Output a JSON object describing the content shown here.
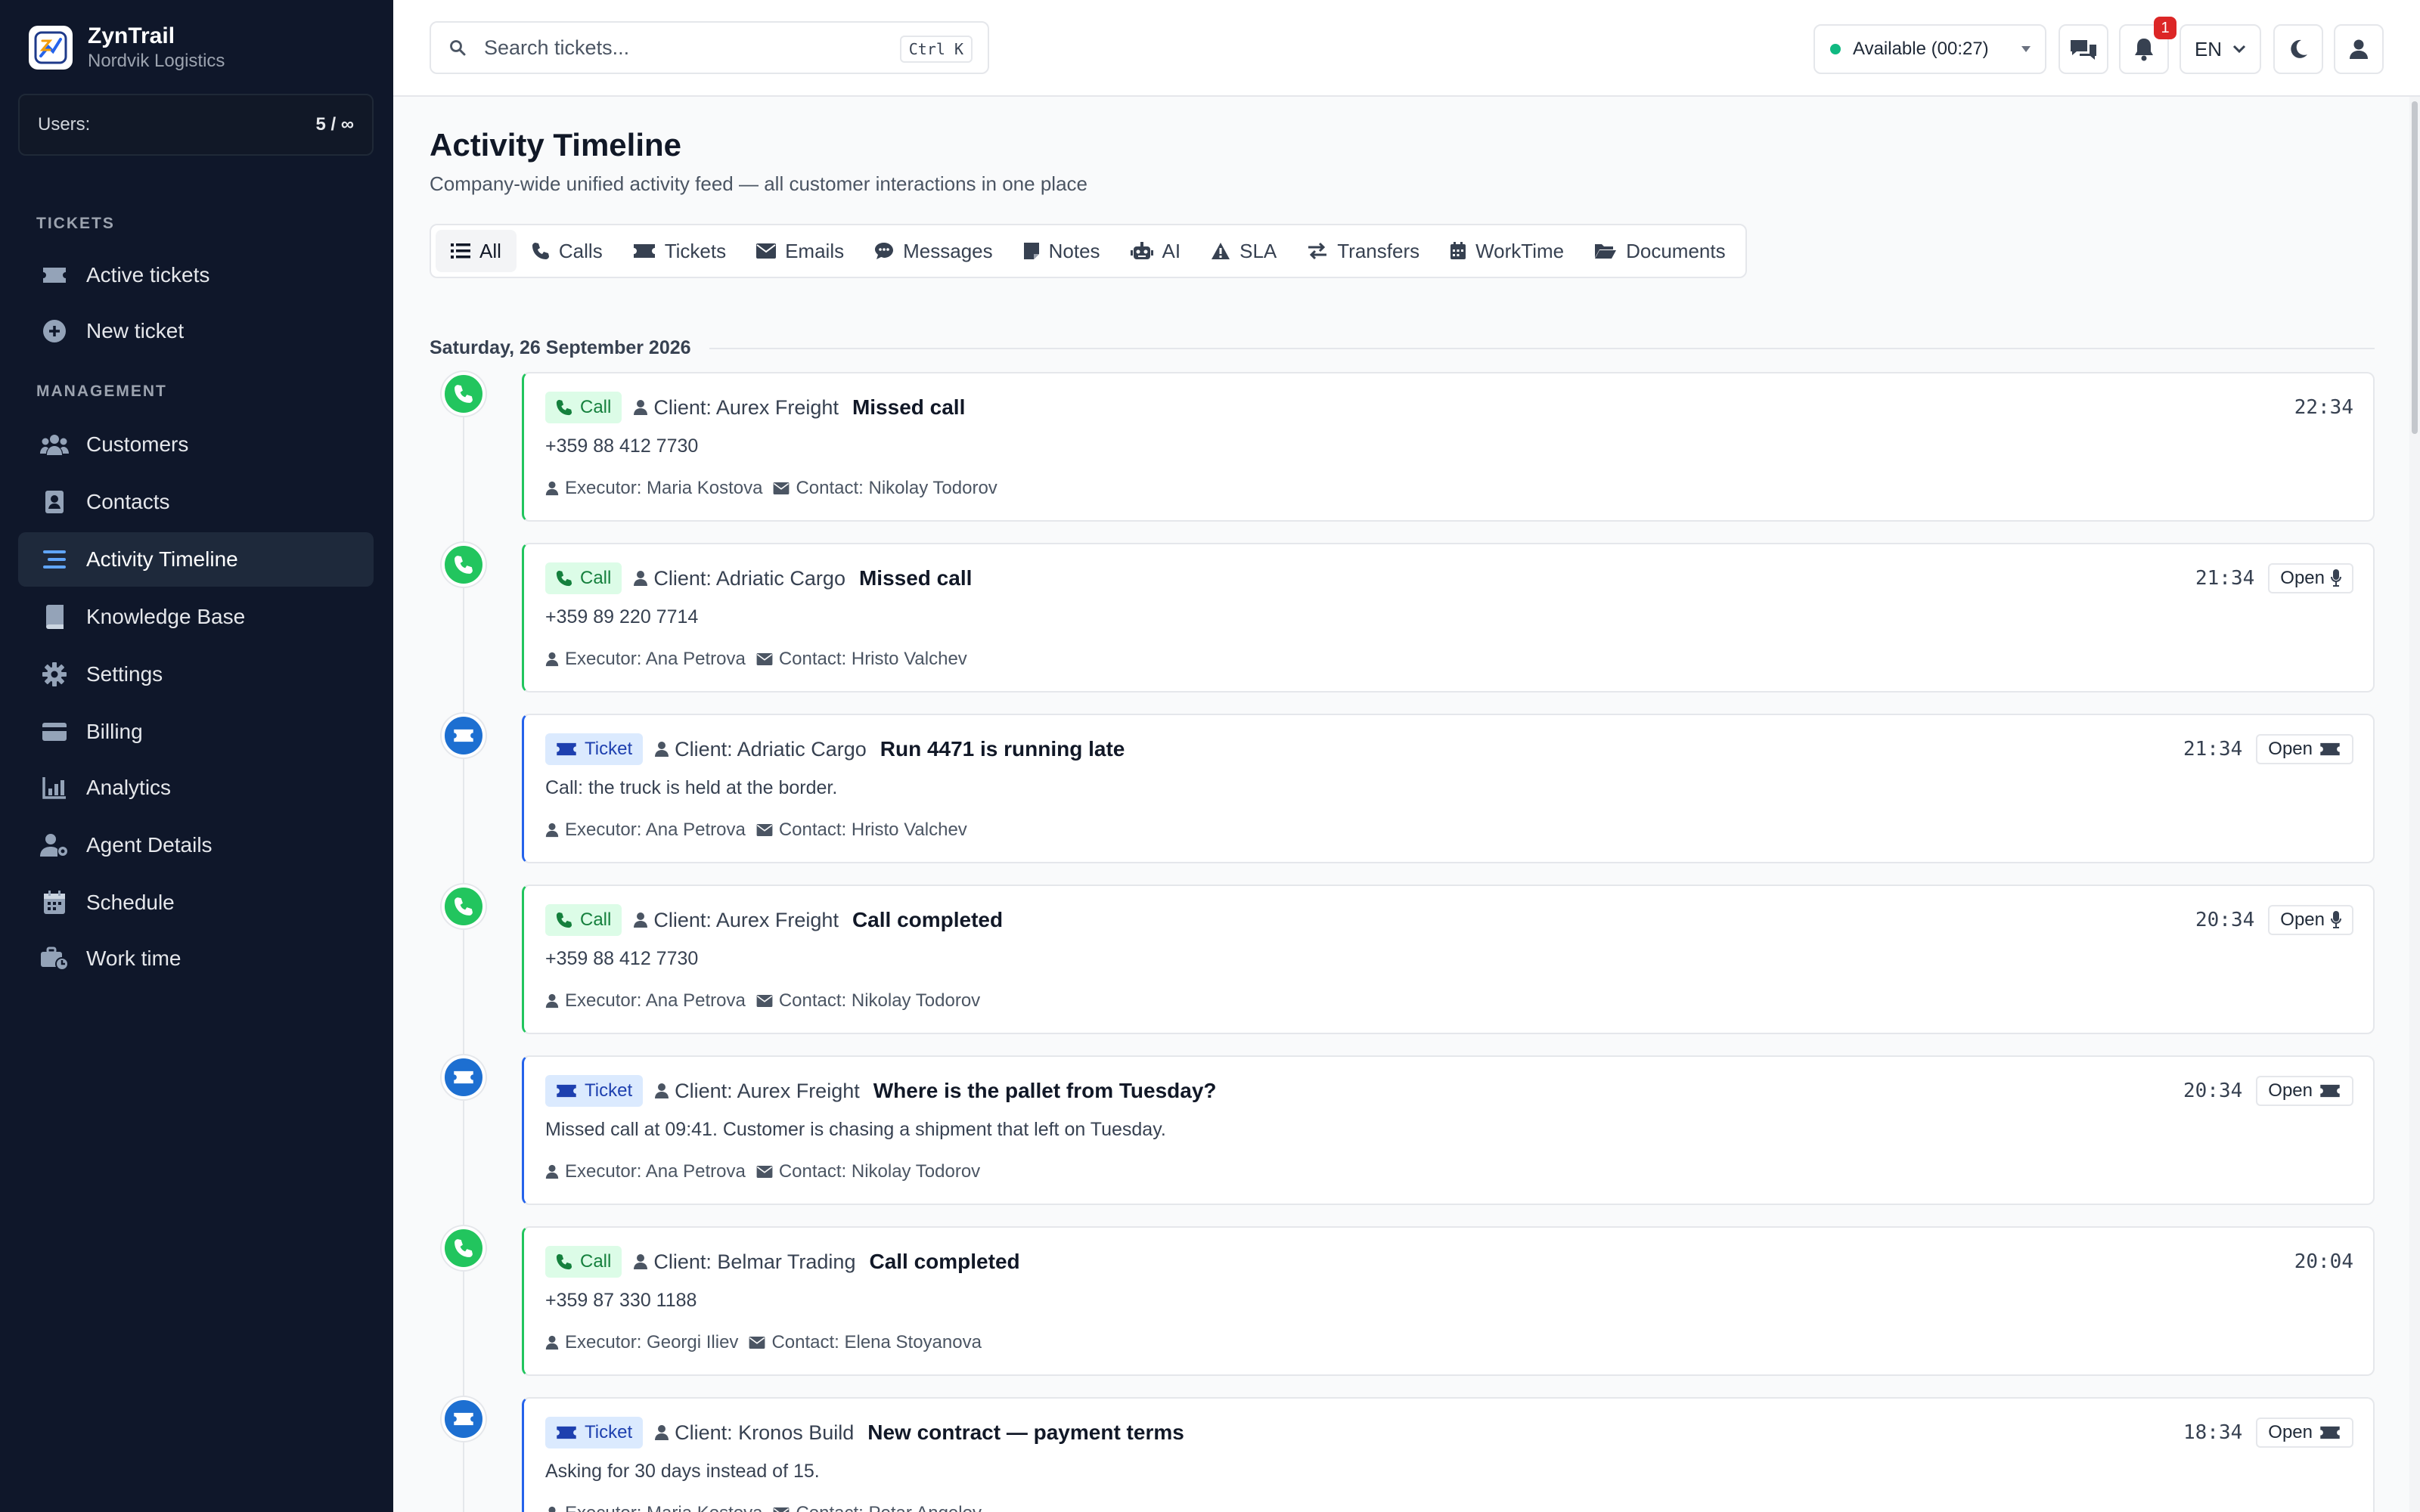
{
  "brand": {
    "name": "ZynTrail",
    "company": "Nordvik Logistics"
  },
  "users": {
    "label": "Users:",
    "value": "5 / ∞"
  },
  "sidebar": {
    "tickets_heading": "TICKETS",
    "management_heading": "MANAGEMENT",
    "items": [
      {
        "label": "Active tickets",
        "icon": "ticket-icon"
      },
      {
        "label": "New ticket",
        "icon": "plus-circle-icon"
      },
      {
        "label": "Customers",
        "icon": "users-icon"
      },
      {
        "label": "Contacts",
        "icon": "contact-book-icon"
      },
      {
        "label": "Activity Timeline",
        "icon": "timeline-icon",
        "active": true
      },
      {
        "label": "Knowledge Base",
        "icon": "book-icon"
      },
      {
        "label": "Settings",
        "icon": "gear-icon"
      },
      {
        "label": "Billing",
        "icon": "credit-card-icon"
      },
      {
        "label": "Analytics",
        "icon": "chart-icon"
      },
      {
        "label": "Agent Details",
        "icon": "user-gear-icon"
      },
      {
        "label": "Schedule",
        "icon": "calendar-icon"
      },
      {
        "label": "Work time",
        "icon": "briefcase-clock-icon"
      }
    ]
  },
  "topbar": {
    "search_placeholder": "Search tickets...",
    "shortcut": "Ctrl K",
    "status": "Available (00:27)",
    "notifications_count": "1",
    "language": "EN"
  },
  "page": {
    "title": "Activity Timeline",
    "subtitle": "Company-wide unified activity feed — all customer interactions in one place"
  },
  "filters": [
    "All",
    "Calls",
    "Tickets",
    "Emails",
    "Messages",
    "Notes",
    "AI",
    "SLA",
    "Transfers",
    "WorkTime",
    "Documents"
  ],
  "date_heading": "Saturday, 26 September 2026",
  "open_label": "Open",
  "events": [
    {
      "type": "call",
      "type_label": "Call",
      "client": "Client: Aurex Freight",
      "title": "Missed call",
      "detail": "+359 88 412 7730",
      "executor": "Executor: Maria Kostova",
      "contact": "Contact: Nikolay Todorov",
      "time": "22:34",
      "has_open": false
    },
    {
      "type": "call",
      "type_label": "Call",
      "client": "Client: Adriatic Cargo",
      "title": "Missed call",
      "detail": "+359 89 220 7714",
      "executor": "Executor: Ana Petrova",
      "contact": "Contact: Hristo Valchev",
      "time": "21:34",
      "has_open": true
    },
    {
      "type": "ticket",
      "type_label": "Ticket",
      "client": "Client: Adriatic Cargo",
      "title": "Run 4471 is running late",
      "detail": "Call: the truck is held at the border.",
      "executor": "Executor: Ana Petrova",
      "contact": "Contact: Hristo Valchev",
      "time": "21:34",
      "has_open": true
    },
    {
      "type": "call",
      "type_label": "Call",
      "client": "Client: Aurex Freight",
      "title": "Call completed",
      "detail": "+359 88 412 7730",
      "executor": "Executor: Ana Petrova",
      "contact": "Contact: Nikolay Todorov",
      "time": "20:34",
      "has_open": true
    },
    {
      "type": "ticket",
      "type_label": "Ticket",
      "client": "Client: Aurex Freight",
      "title": "Where is the pallet from Tuesday?",
      "detail": "Missed call at 09:41. Customer is chasing a shipment that left on Tuesday.",
      "executor": "Executor: Ana Petrova",
      "contact": "Contact: Nikolay Todorov",
      "time": "20:34",
      "has_open": true
    },
    {
      "type": "call",
      "type_label": "Call",
      "client": "Client: Belmar Trading",
      "title": "Call completed",
      "detail": "+359 87 330 1188",
      "executor": "Executor: Georgi Iliev",
      "contact": "Contact: Elena Stoyanova",
      "time": "20:04",
      "has_open": false
    },
    {
      "type": "ticket",
      "type_label": "Ticket",
      "client": "Client: Kronos Build",
      "title": "New contract — payment terms",
      "detail": "Asking for 30 days instead of 15.",
      "executor": "Executor: Maria Kostova",
      "contact": "Contact: Petar Angelov",
      "time": "18:34",
      "has_open": true
    }
  ],
  "colors": {
    "call": "#22c55e",
    "ticket": "#1d6fd1",
    "sidebar_bg": "#0f172a",
    "accent": "#3b82f6"
  }
}
